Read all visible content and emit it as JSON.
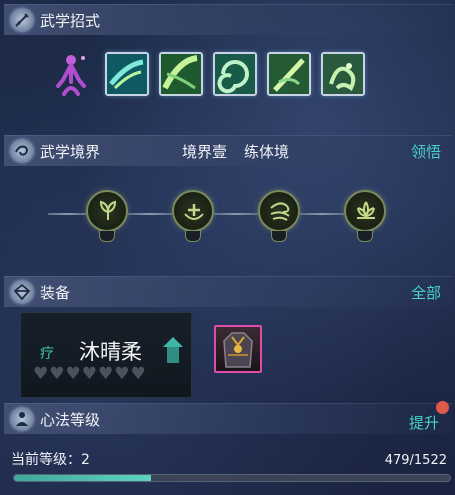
{
  "martial_moves": {
    "title": "武学招式",
    "icon": "sword-icon",
    "skills": [
      {
        "icon": "skill-sword-dash-icon"
      },
      {
        "icon": "skill-leaf-sweep-icon"
      },
      {
        "icon": "skill-whirlwind-icon"
      },
      {
        "icon": "skill-blade-strike-icon"
      },
      {
        "icon": "skill-dragon-icon"
      }
    ]
  },
  "martial_realm": {
    "title": "武学境界",
    "realm_level": "境界壹",
    "realm_name": "练体境",
    "action": "领悟",
    "nodes": [
      "leaf-sprout-icon",
      "healing-plus-icon",
      "wind-swirl-icon",
      "lotus-icon"
    ]
  },
  "equipment": {
    "title": "装备",
    "action": "全部",
    "card": {
      "name": "沐晴柔",
      "class_glyph": "疗",
      "hearts": 7,
      "hearts_filled": 0
    },
    "slot_item": "armor-item-icon"
  },
  "heart_method": {
    "title": "心法等级",
    "action": "提升",
    "level_label": "当前等级：2",
    "exp_text": "479/1522",
    "progress": 0.3147
  },
  "colors": {
    "accent": "#49d2c9",
    "notification": "#e05a4a",
    "equip_border": "#e04aa8"
  }
}
